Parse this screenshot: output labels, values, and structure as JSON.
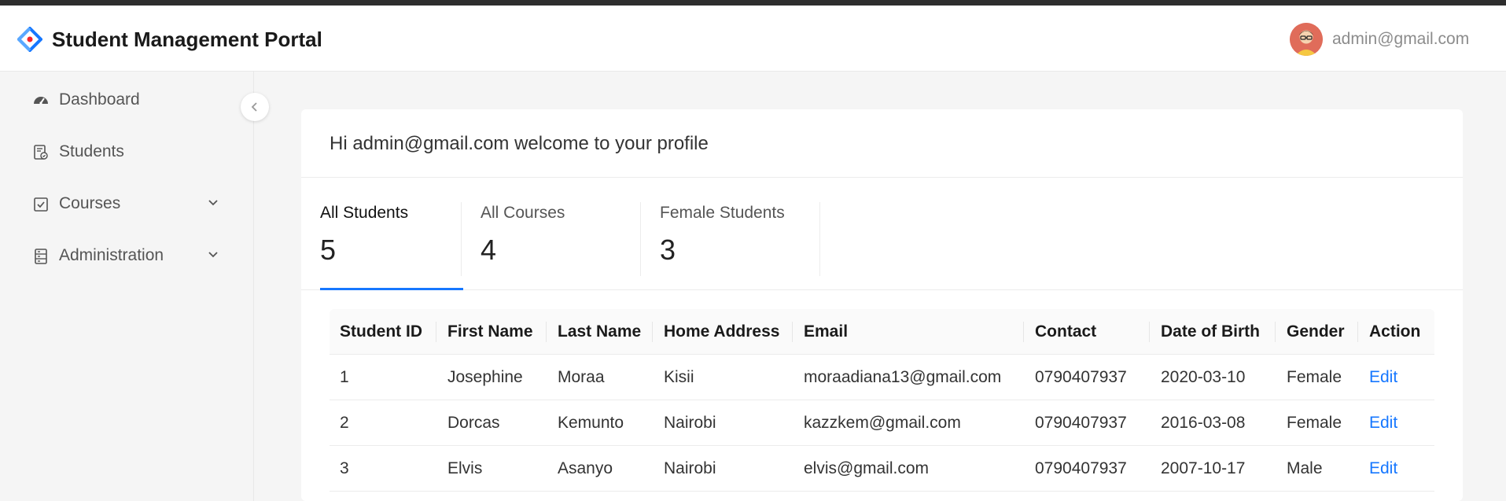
{
  "header": {
    "title": "Student Management Portal",
    "user_email": "admin@gmail.com"
  },
  "sidebar": {
    "items": [
      {
        "label": "Dashboard",
        "icon": "dashboard-icon"
      },
      {
        "label": "Students",
        "icon": "students-icon"
      },
      {
        "label": "Courses",
        "icon": "courses-icon",
        "expandable": true
      },
      {
        "label": "Administration",
        "icon": "administration-icon",
        "expandable": true
      }
    ]
  },
  "main": {
    "welcome": "Hi admin@gmail.com welcome to your profile",
    "stats": [
      {
        "label": "All Students",
        "value": "5",
        "active": true
      },
      {
        "label": "All Courses",
        "value": "4"
      },
      {
        "label": "Female Students",
        "value": "3"
      }
    ],
    "table": {
      "columns": [
        "Student ID",
        "First Name",
        "Last Name",
        "Home Address",
        "Email",
        "Contact",
        "Date of Birth",
        "Gender",
        "Action"
      ],
      "rows": [
        [
          "1",
          "Josephine",
          "Moraa",
          "Kisii",
          "moraadiana13@gmail.com",
          "0790407937",
          "2020-03-10",
          "Female",
          "Edit"
        ],
        [
          "2",
          "Dorcas",
          "Kemunto",
          "Nairobi",
          "kazzkem@gmail.com",
          "0790407937",
          "2016-03-08",
          "Female",
          "Edit"
        ],
        [
          "3",
          "Elvis",
          "Asanyo",
          "Nairobi",
          "elvis@gmail.com",
          "0790407937",
          "2007-10-17",
          "Male",
          "Edit"
        ]
      ]
    }
  },
  "colors": {
    "accent": "#1677ff",
    "topbar": "#2e2e2e"
  }
}
